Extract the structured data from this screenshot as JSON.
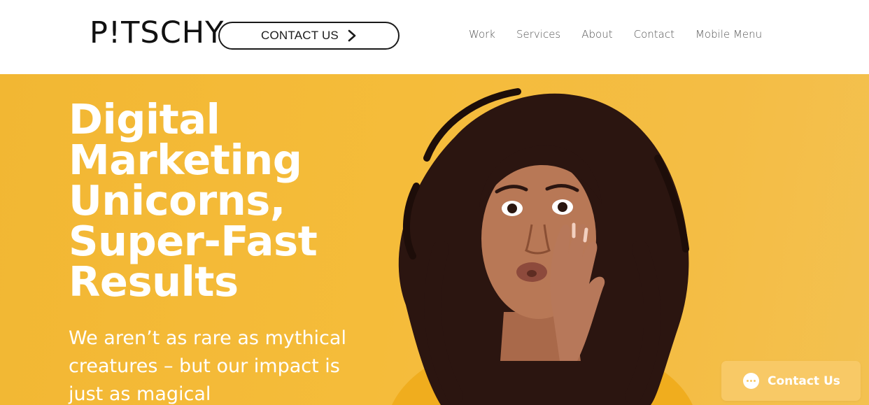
{
  "header": {
    "logo": "P!TSCHY",
    "contact_button": "CONTACT US",
    "nav": [
      "Work",
      "Services",
      "About",
      "Contact",
      "Mobile Menu"
    ]
  },
  "hero": {
    "headline": [
      "Digital",
      "Marketing",
      "Unicorns,",
      "Super-Fast",
      "Results"
    ],
    "subline": [
      "We aren’t as rare as mythical",
      "creatures – but our impact is",
      "just as magical"
    ]
  },
  "chat_widget": {
    "label": "Contact Us"
  },
  "colors": {
    "hero_bg": "#f4bb3c",
    "chat_bg": "#f8c966",
    "text_dark": "#111111",
    "nav_text": "#555555"
  },
  "icons": [
    "chevron-right-icon",
    "chat-bubble-icon"
  ]
}
